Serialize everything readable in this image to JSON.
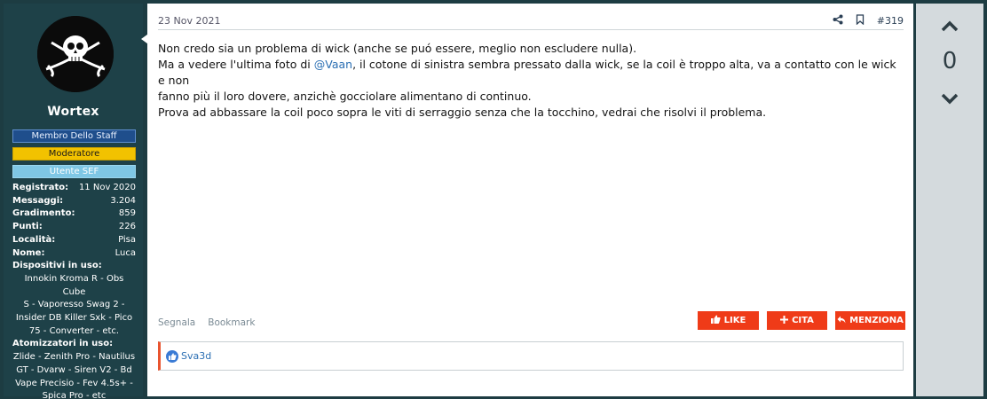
{
  "user": {
    "name": "Wortex",
    "badges": [
      "Membro Dello Staff",
      "Moderatore",
      "Utente SEF"
    ],
    "stats": [
      {
        "label": "Registrato:",
        "value": "11 Nov 2020"
      },
      {
        "label": "Messaggi:",
        "value": "3.204"
      },
      {
        "label": "Gradimento:",
        "value": "859"
      },
      {
        "label": "Punti:",
        "value": "226"
      },
      {
        "label": "Località:",
        "value": "Pisa"
      },
      {
        "label": "Nome:",
        "value": "Luca"
      }
    ],
    "devices_label": "Dispositivi in uso:",
    "devices_lines": [
      "Innokin Kroma R - Obs Cube",
      "S - Vaporesso Swag 2 -",
      "Insider DB Killer Sxk - Pico",
      "75 - Converter - etc."
    ],
    "atomizers_label": "Atomizzatori in uso:",
    "atomizers_lines": [
      "Zlide - Zenith Pro - Nautilus",
      "GT - Dvarw - Siren V2 - Bd",
      "Vape Precisio - Fev 4.5s+ -",
      "Spica Pro - etc"
    ]
  },
  "post": {
    "date": "23 Nov 2021",
    "number": "#319",
    "line1": "Non credo sia un problema di wick (anche se puó essere, meglio non escludere nulla).",
    "line2_before": "Ma a vedere l'ultima foto di ",
    "mention": "@Vaan",
    "line2_after": ", il cotone di sinistra sembra pressato dalla wick, se la coil è troppo alta, va a contatto con le wick e non",
    "line3": "fanno più il loro dovere, anzichè gocciolare alimentano di continuo.",
    "line4": "Prova ad abbassare la coil poco sopra le viti di serraggio senza che la tocchino, vedrai che risolvi il problema."
  },
  "footer": {
    "report_label": "Segnala",
    "bookmark_label": "Bookmark",
    "like_label": "LIKE",
    "quote_label": "CITA",
    "mention_label": "MENZIONA"
  },
  "likes": {
    "users": "Sva3d"
  },
  "vote": {
    "count": "0"
  },
  "icons": {
    "share": "share-icon",
    "bookmark": "bookmark-icon",
    "up": "chevron-up-icon",
    "down": "chevron-down-icon",
    "like": "thumbs-up-icon",
    "plus": "plus-icon",
    "reply": "reply-icon"
  },
  "colors": {
    "accent": "#ef3b18",
    "staff_badge": "#1f4e8c",
    "moderator_badge": "#f2c200",
    "sef_badge": "#7fc7e5",
    "link": "#2b6fb3"
  }
}
